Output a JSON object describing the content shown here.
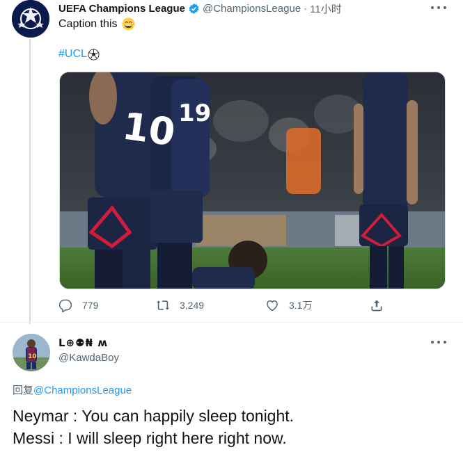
{
  "tweet": {
    "author_name": "UEFA Champions League",
    "handle": "@ChampionsLeague",
    "separator": "·",
    "time": "11小时",
    "text": "Caption this",
    "hashtag": "#UCL",
    "stats": {
      "replies": "779",
      "retweets": "3,249",
      "likes": "3.1万"
    }
  },
  "reply": {
    "author_name": "L⊕⚉₦ ʍ",
    "handle": "@KawdaBoy",
    "reply_label": "回复",
    "reply_mention": "@ChampionsLeague",
    "line1": "Neymar : You can happily sleep tonight.",
    "line2": "Messi : I will sleep right here right now."
  },
  "colors": {
    "accent": "#1d9bf0",
    "text_primary": "#0f1419",
    "text_secondary": "#536471",
    "line": "#cfd9de"
  },
  "icons": [
    "verified-badge-icon",
    "more-icon",
    "grinning-emoji-icon",
    "soccer-ball-icon",
    "reply-icon",
    "retweet-icon",
    "like-icon",
    "share-icon"
  ]
}
